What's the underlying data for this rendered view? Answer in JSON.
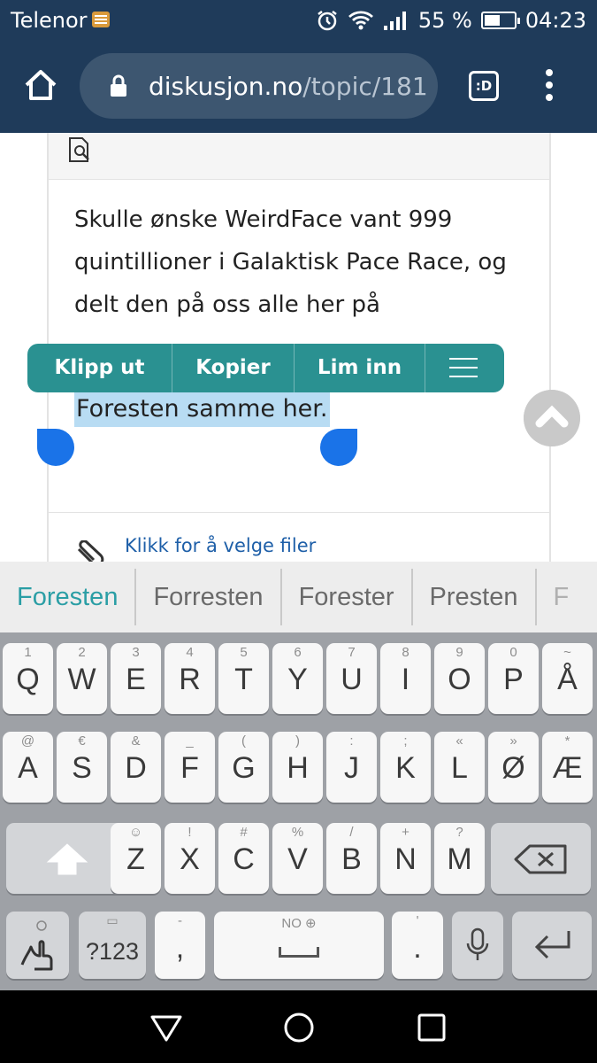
{
  "status_bar": {
    "carrier": "Telenor",
    "battery_percent": "55 %",
    "battery_level": 0.55,
    "time": "04:23"
  },
  "browser": {
    "url_domain": "diskusjon.no",
    "url_path": "/topic/181",
    "tabs_label": ":D"
  },
  "post": {
    "text": "Skulle ønske WeirdFace vant 999 quintillioner i Galaktisk Pace Race, og delt den på oss alle her på",
    "selected_text": "Foresten samme her.",
    "attach_link": "Klikk for å velge filer"
  },
  "context_menu": {
    "cut": "Klipp ut",
    "copy": "Kopier",
    "paste": "Lim inn"
  },
  "suggestions": [
    "Foresten",
    "Forresten",
    "Forester",
    "Presten",
    "F"
  ],
  "keyboard": {
    "row1": [
      {
        "hint": "1",
        "key": "Q"
      },
      {
        "hint": "2",
        "key": "W"
      },
      {
        "hint": "3",
        "key": "E"
      },
      {
        "hint": "4",
        "key": "R"
      },
      {
        "hint": "5",
        "key": "T"
      },
      {
        "hint": "6",
        "key": "Y"
      },
      {
        "hint": "7",
        "key": "U"
      },
      {
        "hint": "8",
        "key": "I"
      },
      {
        "hint": "9",
        "key": "O"
      },
      {
        "hint": "0",
        "key": "P"
      },
      {
        "hint": "~",
        "key": "Å"
      }
    ],
    "row2": [
      {
        "hint": "@",
        "key": "A"
      },
      {
        "hint": "€",
        "key": "S"
      },
      {
        "hint": "&",
        "key": "D"
      },
      {
        "hint": "_",
        "key": "F"
      },
      {
        "hint": "(",
        "key": "G"
      },
      {
        "hint": ")",
        "key": "H"
      },
      {
        "hint": ":",
        "key": "J"
      },
      {
        "hint": ";",
        "key": "K"
      },
      {
        "hint": "«",
        "key": "L"
      },
      {
        "hint": "»",
        "key": "Ø"
      },
      {
        "hint": "*",
        "key": "Æ"
      }
    ],
    "row3": [
      {
        "hint": "☺",
        "key": "Z"
      },
      {
        "hint": "!",
        "key": "X"
      },
      {
        "hint": "#",
        "key": "C"
      },
      {
        "hint": "%",
        "key": "V"
      },
      {
        "hint": "/",
        "key": "B"
      },
      {
        "hint": "+",
        "key": "N"
      },
      {
        "hint": "?",
        "key": "M"
      }
    ],
    "symbols_label": "?123",
    "comma_hint": "-",
    "comma_key": ",",
    "space_language": "NO",
    "period_hint": "'",
    "period_key": "."
  },
  "colors": {
    "header_bg": "#1f3b5a",
    "context_menu_bg": "#2a9191",
    "selection_bg": "#b8dcf3",
    "selection_handle": "#1a73e8",
    "suggestion_active": "#2a9ea5",
    "link": "#1e5fa8"
  },
  "icons": [
    "alarm-icon",
    "wifi-icon",
    "signal-icon",
    "battery-icon",
    "home-icon",
    "lock-icon",
    "menu-dots-icon",
    "preview-icon",
    "paperclip-icon",
    "scroll-top-icon",
    "hamburger-icon",
    "shift-icon",
    "backspace-icon",
    "emoji-settings-icon",
    "mic-icon",
    "enter-icon",
    "back-icon",
    "home-circle-icon",
    "recents-icon"
  ]
}
